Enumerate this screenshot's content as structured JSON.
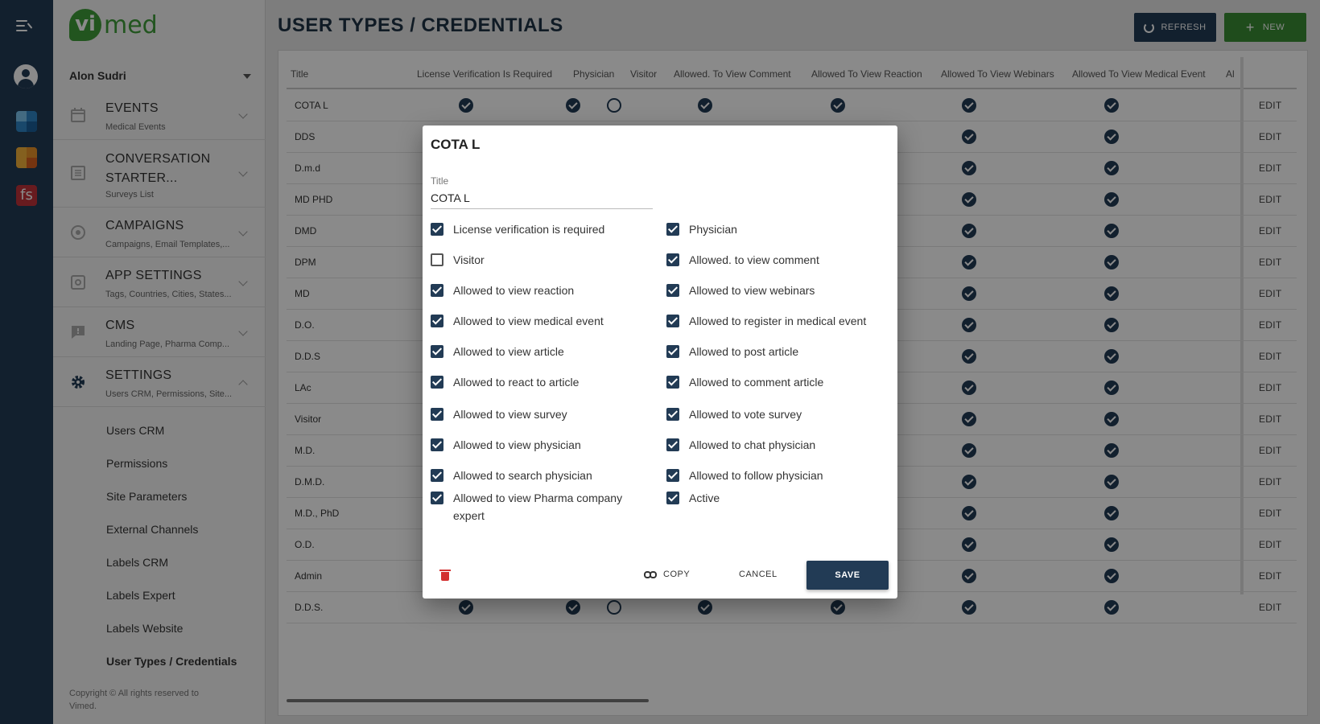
{
  "app": {
    "logo_vi": "vi",
    "logo_med": "med",
    "user": "Alon Sudri",
    "copyright": "Copyright © All rights reserved to Vimed.",
    "app3_glyph": "fs"
  },
  "rail": {
    "icons": [
      "menu-icon",
      "user-avatar-icon",
      "app-blue-icon",
      "app-orange-icon",
      "app-fs-icon"
    ]
  },
  "sidebar": {
    "sections": [
      {
        "title": "EVENTS",
        "subtitle": "Medical Events",
        "icon": "calendar-icon"
      },
      {
        "title": "CONVERSATION STARTER...",
        "subtitle": "Surveys List",
        "icon": "list-icon"
      },
      {
        "title": "CAMPAIGNS",
        "subtitle": "Campaigns, Email Templates,...",
        "icon": "campaign-icon"
      },
      {
        "title": "APP SETTINGS",
        "subtitle": "Tags, Countries, Cities, States...",
        "icon": "app-settings-icon"
      },
      {
        "title": "CMS",
        "subtitle": "Landing Page, Pharma Comp...",
        "icon": "comment-icon"
      },
      {
        "title": "SETTINGS",
        "subtitle": "Users CRM, Permissions, Site...",
        "icon": "gear-icon"
      }
    ],
    "sub_items": [
      "Users CRM",
      "Permissions",
      "Site Parameters",
      "External Channels",
      "Labels CRM",
      "Labels Expert",
      "Labels Website",
      "User Types / Credentials"
    ]
  },
  "header": {
    "title": "USER TYPES / CREDENTIALS",
    "refresh": "REFRESH",
    "new": "NEW",
    "new_icon": "+"
  },
  "table": {
    "headers": [
      "Title",
      "License Verification Is Required",
      "Physician",
      "Visitor",
      "Allowed. To View Comment",
      "Allowed To View Reaction",
      "Allowed To View Webinars",
      "Allowed To View Medical Event",
      "Al"
    ],
    "rows": [
      "COTA L",
      "DDS",
      "D.m.d",
      "MD PHD",
      "DMD",
      "DPM",
      "MD",
      "D.O.",
      "D.D.S",
      "LAc",
      "Visitor",
      "M.D.",
      "D.M.D.",
      "M.D., PhD",
      "O.D.",
      "Admin",
      "D.D.S."
    ],
    "edit_label": "EDIT"
  },
  "modal": {
    "title": "COTA L",
    "field_label": "Title",
    "field_value": "COTA L",
    "left": [
      {
        "label": "License verification is required",
        "checked": true
      },
      {
        "label": "Visitor",
        "checked": false
      },
      {
        "label": "Allowed to view reaction",
        "checked": true
      },
      {
        "label": "Allowed to view medical event",
        "checked": true
      },
      {
        "label": "Allowed to view article",
        "checked": true
      },
      {
        "label": "Allowed to react to article",
        "checked": true
      },
      {
        "label": "Allowed to view survey",
        "checked": true
      },
      {
        "label": "Allowed to view physician",
        "checked": true
      },
      {
        "label": "Allowed to search physician",
        "checked": true
      },
      {
        "label": "Allowed to view Pharma company expert",
        "checked": true
      }
    ],
    "right": [
      {
        "label": "Physician",
        "checked": true
      },
      {
        "label": "Allowed. to view comment",
        "checked": true
      },
      {
        "label": "Allowed to view webinars",
        "checked": true
      },
      {
        "label": "Allowed to register in medical event",
        "checked": true
      },
      {
        "label": "Allowed to post article",
        "checked": true
      },
      {
        "label": "Allowed to comment article",
        "checked": true
      },
      {
        "label": "Allowed to vote survey",
        "checked": true
      },
      {
        "label": "Allowed to chat physician",
        "checked": true
      },
      {
        "label": "Allowed to follow physician",
        "checked": true
      },
      {
        "label": "Active",
        "checked": true
      }
    ],
    "copy": "COPY",
    "cancel": "CANCEL",
    "save": "SAVE"
  }
}
